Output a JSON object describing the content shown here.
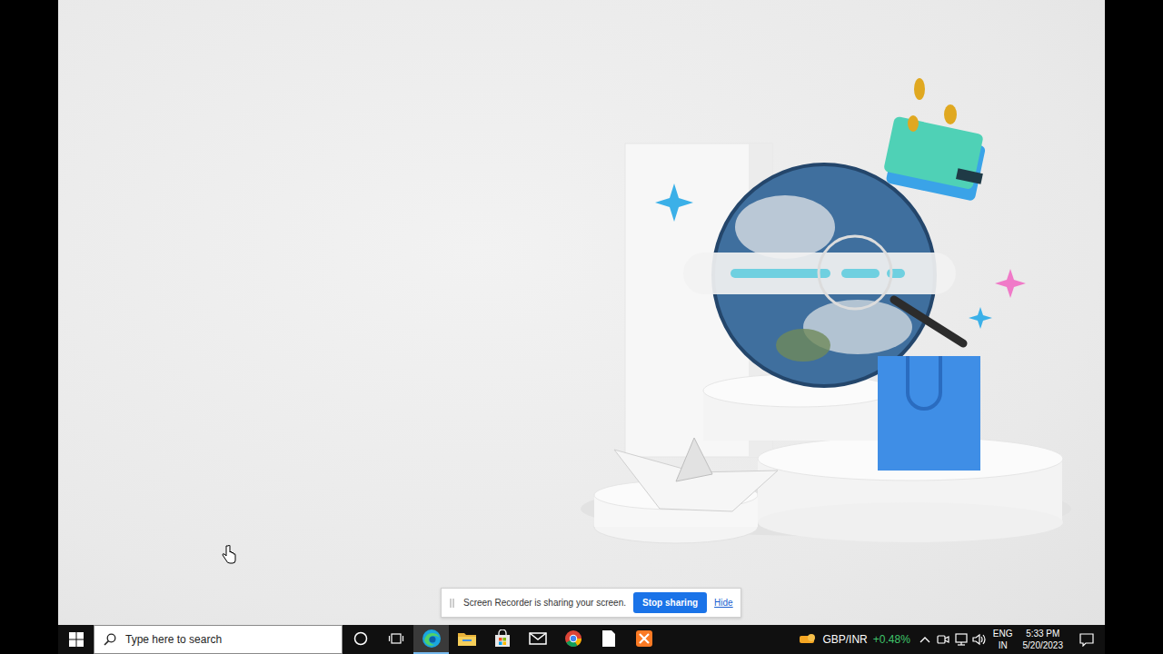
{
  "screen_recorder": {
    "message": "Screen Recorder is sharing your screen.",
    "stop_button": "Stop sharing",
    "hide_link": "Hide"
  },
  "taskbar": {
    "search": {
      "placeholder": "Type here to search"
    },
    "apps": [
      {
        "kind": "cortana",
        "selected": false
      },
      {
        "kind": "taskview",
        "selected": false
      },
      {
        "kind": "edge",
        "selected": true
      },
      {
        "kind": "explorer",
        "selected": false
      },
      {
        "kind": "store",
        "selected": false
      },
      {
        "kind": "mail",
        "selected": false
      },
      {
        "kind": "chrome",
        "selected": false
      },
      {
        "kind": "notepad",
        "selected": false
      },
      {
        "kind": "xampp",
        "selected": false
      }
    ],
    "ticker": {
      "symbol": "GBP/INR",
      "change": "+0.48%"
    },
    "tray": {
      "language": "ENG",
      "region": "IN",
      "time": "5:33 PM",
      "date": "5/20/2023"
    }
  }
}
